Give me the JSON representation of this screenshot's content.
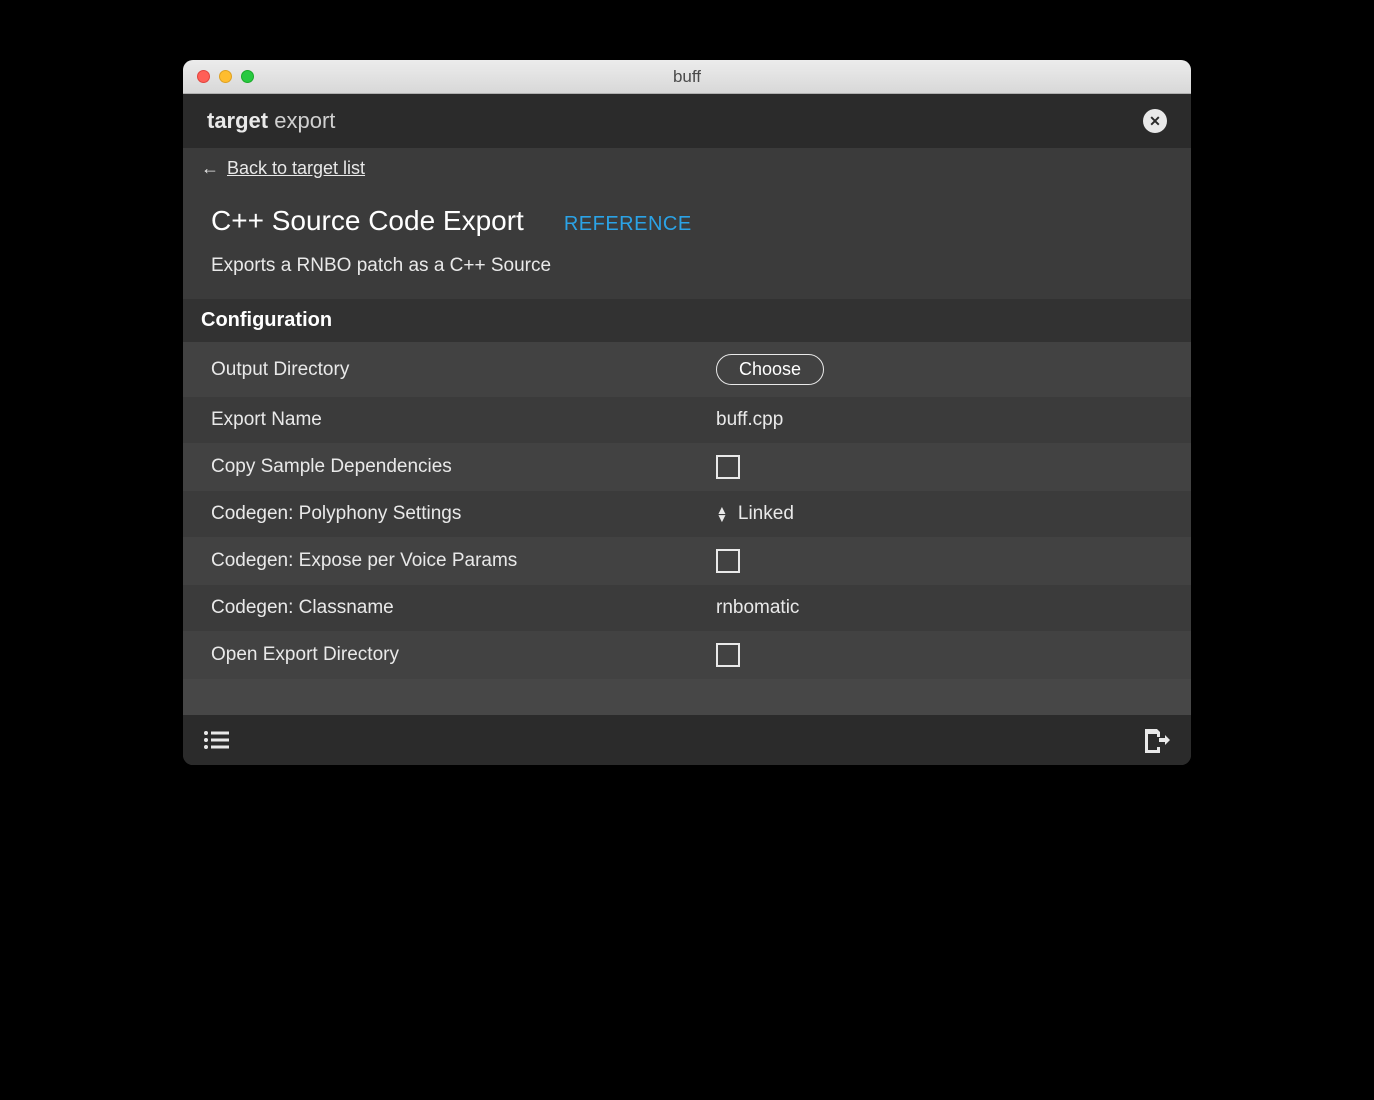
{
  "window": {
    "title": "buff"
  },
  "panel": {
    "title_bold": "target",
    "title_light": "export"
  },
  "back": {
    "label": "Back to target list"
  },
  "export": {
    "title": "C++ Source Code Export",
    "reference": "REFERENCE",
    "description": "Exports a RNBO patch as a C++ Source"
  },
  "section": {
    "header": "Configuration"
  },
  "rows": {
    "output_directory": {
      "label": "Output Directory",
      "button": "Choose"
    },
    "export_name": {
      "label": "Export Name",
      "value": "buff.cpp"
    },
    "copy_deps": {
      "label": "Copy Sample Dependencies"
    },
    "polyphony": {
      "label": "Codegen: Polyphony Settings",
      "value": "Linked"
    },
    "voice_params": {
      "label": "Codegen: Expose per Voice Params"
    },
    "classname": {
      "label": "Codegen: Classname",
      "value": "rnbomatic"
    },
    "open_dir": {
      "label": "Open Export Directory"
    }
  }
}
